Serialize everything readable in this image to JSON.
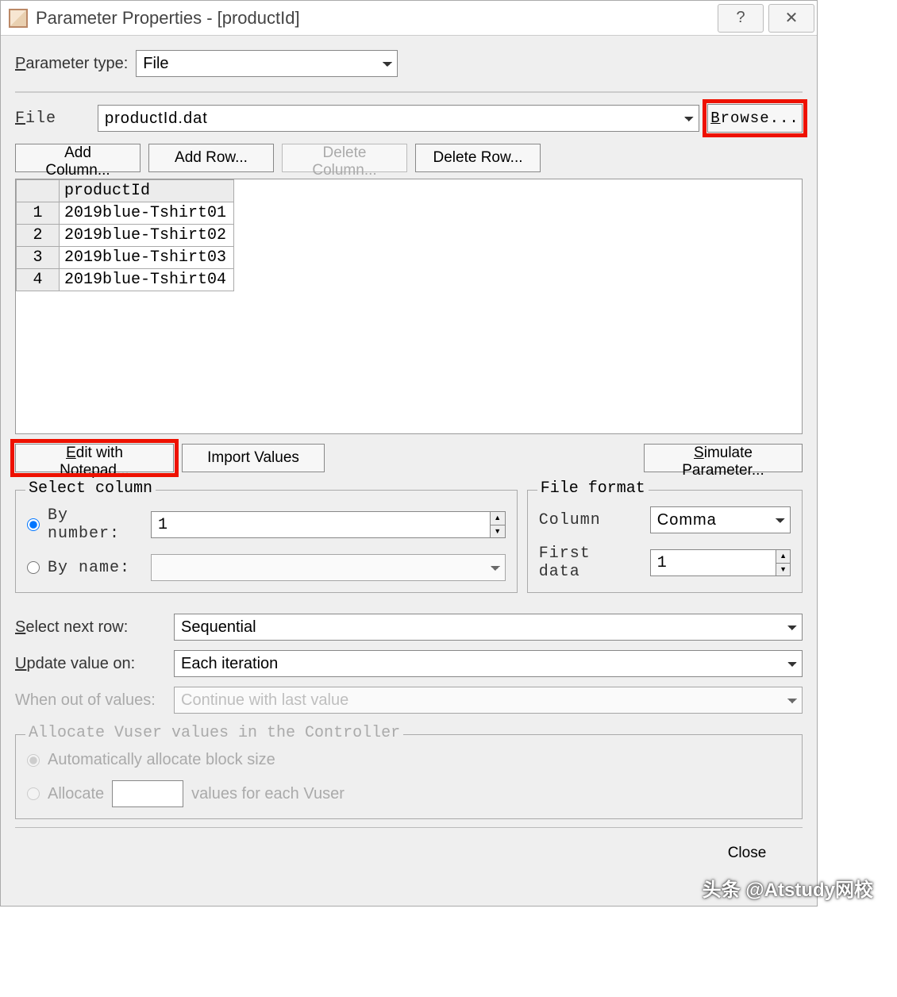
{
  "window": {
    "title": "Parameter Properties - [productId]",
    "help_icon": "?",
    "close_icon": "✕"
  },
  "form": {
    "param_type_label": "Parameter type:",
    "param_type_value": "File",
    "file_label": "File",
    "file_value": "productId.dat",
    "browse_btn": "Browse..."
  },
  "toolbar": {
    "add_column": "Add Column...",
    "add_row": "Add Row...",
    "delete_column": "Delete Column...",
    "delete_row": "Delete Row..."
  },
  "table": {
    "column_header": "productId",
    "rows": [
      {
        "n": "1",
        "v": "2019blue-Tshirt01"
      },
      {
        "n": "2",
        "v": "2019blue-Tshirt02"
      },
      {
        "n": "3",
        "v": "2019blue-Tshirt03"
      },
      {
        "n": "4",
        "v": "2019blue-Tshirt04"
      }
    ]
  },
  "actions": {
    "edit_notepad": "Edit with Notepad...",
    "import_values": "Import Values",
    "simulate": "Simulate Parameter..."
  },
  "select_column": {
    "legend": "Select column",
    "by_number_label": "By number:",
    "by_number_value": "1",
    "by_name_label": "By name:",
    "by_name_value": ""
  },
  "file_format": {
    "legend": "File format",
    "column_label": "Column",
    "column_value": "Comma",
    "first_data_label": "First data",
    "first_data_value": "1"
  },
  "lower": {
    "select_next_label": "Select next row:",
    "select_next_value": "Sequential",
    "update_label": "Update value on:",
    "update_value": "Each iteration",
    "when_out_label": "When out of values:",
    "when_out_value": "Continue with last value"
  },
  "allocate": {
    "legend": "Allocate Vuser values in the Controller",
    "auto_label": "Automatically allocate block size",
    "allocate_label": "Allocate",
    "values_each": "values for each Vuser"
  },
  "footer": {
    "close": "Close"
  },
  "watermark": "头条 @Atstudy网校"
}
